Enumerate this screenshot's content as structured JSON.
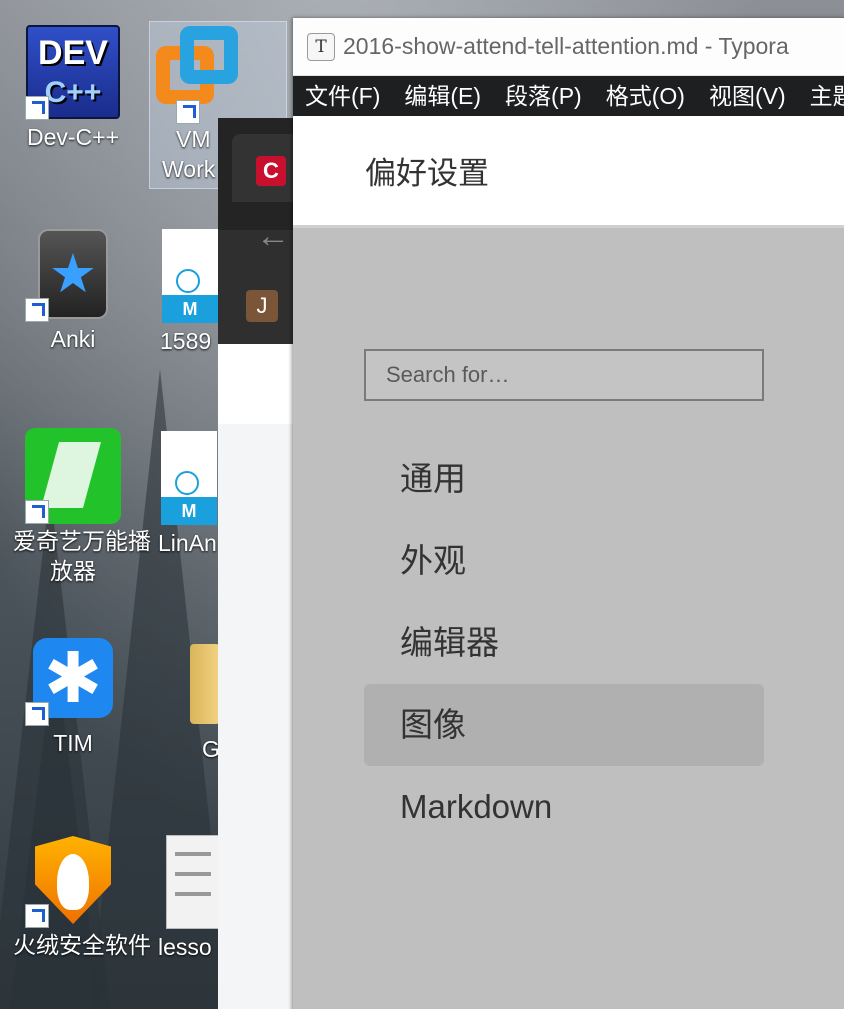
{
  "desktop": {
    "icons": [
      {
        "label_lines": [
          "Dev-C++"
        ],
        "icon": "dev-cpp-icon"
      },
      {
        "label_lines": [
          "VM",
          "Work"
        ],
        "icon": "vmware-icon"
      },
      {
        "label_lines": [
          "Anki"
        ],
        "icon": "anki-icon"
      },
      {
        "label_lines": [
          "1589"
        ],
        "icon": "markdown-file-icon"
      },
      {
        "label_lines": [
          "爱奇艺万能播",
          "放器"
        ],
        "icon": "iqiyi-player-icon"
      },
      {
        "label_lines": [
          "LinAn"
        ],
        "icon": "markdown-file-icon"
      },
      {
        "label_lines": [
          "TIM"
        ],
        "icon": "tim-icon"
      },
      {
        "label_lines": [
          "G"
        ],
        "icon": "folder-icon"
      },
      {
        "label_lines": [
          "火绒安全软件"
        ],
        "icon": "huorong-icon"
      },
      {
        "label_lines": [
          "lesso"
        ],
        "icon": "text-file-icon"
      }
    ],
    "file_badge": "M",
    "dev_logo_top": "DEV",
    "dev_logo_bottom": "C++"
  },
  "browser": {
    "favicon_letter": "C",
    "back_glyph": "←",
    "extension_letter": "J"
  },
  "typora": {
    "app_icon_letter": "T",
    "window_title": "2016-show-attend-tell-attention.md - Typora",
    "menu": [
      "文件(F)",
      "编辑(E)",
      "段落(P)",
      "格式(O)",
      "视图(V)",
      "主题(T)"
    ],
    "preferences": {
      "title": "偏好设置",
      "search_placeholder": "Search for…",
      "nav": [
        "通用",
        "外观",
        "编辑器",
        "图像",
        "Markdown"
      ],
      "active": "图像"
    }
  }
}
